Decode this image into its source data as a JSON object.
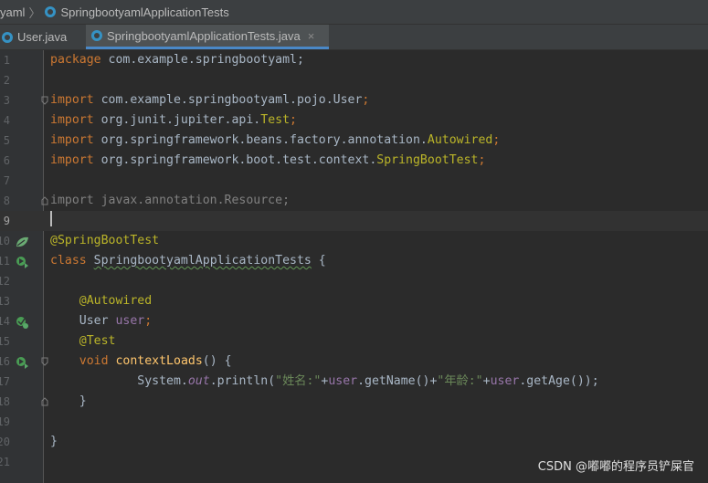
{
  "breadcrumb": {
    "project": "yaml",
    "file": "SpringbootyamlApplicationTests"
  },
  "tabs": [
    {
      "label": "User.java",
      "close": "×"
    },
    {
      "label": "SpringbootyamlApplicationTests.java",
      "close": "×"
    }
  ],
  "line_numbers": [
    "1",
    "2",
    "3",
    "4",
    "5",
    "6",
    "7",
    "8",
    "9",
    "10",
    "11",
    "12",
    "13",
    "14",
    "15",
    "16",
    "17",
    "18",
    "19",
    "20",
    "21"
  ],
  "code": {
    "l1": {
      "kw": "package",
      "rest": " com.example.springbootyaml;"
    },
    "l3": {
      "kw": "import",
      "a": " com.example.springbootyaml.pojo.User",
      "semi": ";"
    },
    "l4": {
      "kw": "import",
      "a": " org.junit.jupiter.api.",
      "cls": "Test",
      "semi": ";"
    },
    "l5": {
      "kw": "import",
      "a": " org.springframework.beans.factory.annotation.",
      "cls": "Autowired",
      "semi": ";"
    },
    "l6": {
      "kw": "import",
      "a": " org.springframework.boot.test.context.",
      "cls": "SpringBootTest",
      "semi": ";"
    },
    "l8": {
      "text": "import javax.annotation.Resource;"
    },
    "l10": {
      "ann": "@SpringBootTest"
    },
    "l11": {
      "kw": "class",
      "name": "SpringbootyamlApplicationTests",
      "rest": " {"
    },
    "l13": {
      "ann": "@Autowired"
    },
    "l14": {
      "type": "User",
      "field": "user",
      "semi": ";"
    },
    "l15": {
      "ann": "@Test"
    },
    "l16": {
      "kw": "void",
      "fn": "contextLoads",
      "rest": "() {"
    },
    "l17": {
      "a": "System.",
      "out": "out",
      "b": ".println(",
      "s1": "\"姓名:\"",
      "c": "+",
      "f1": "user",
      "d": ".getName()+",
      "s2": "\"年龄:\"",
      "e": "+",
      "f2": "user",
      "f": ".getAge());"
    },
    "l18": {
      "text": "}"
    },
    "l20": {
      "text": "}"
    }
  },
  "watermark": "CSDN @嘟嘟的程序员铲屎官",
  "colors": {
    "background": "#2b2b2b",
    "gutter": "#313335",
    "keyword": "#cc7832",
    "annotation": "#bbb529",
    "field": "#9876aa",
    "string": "#6a8759",
    "method": "#ffc66d",
    "text": "#a9b7c6",
    "tab_underline": "#4a88c7"
  },
  "icons": [
    "java-class-icon",
    "spring-bean-icon",
    "run-test-icon",
    "autowired-bean-icon",
    "fold-marker-icon",
    "close-icon"
  ]
}
